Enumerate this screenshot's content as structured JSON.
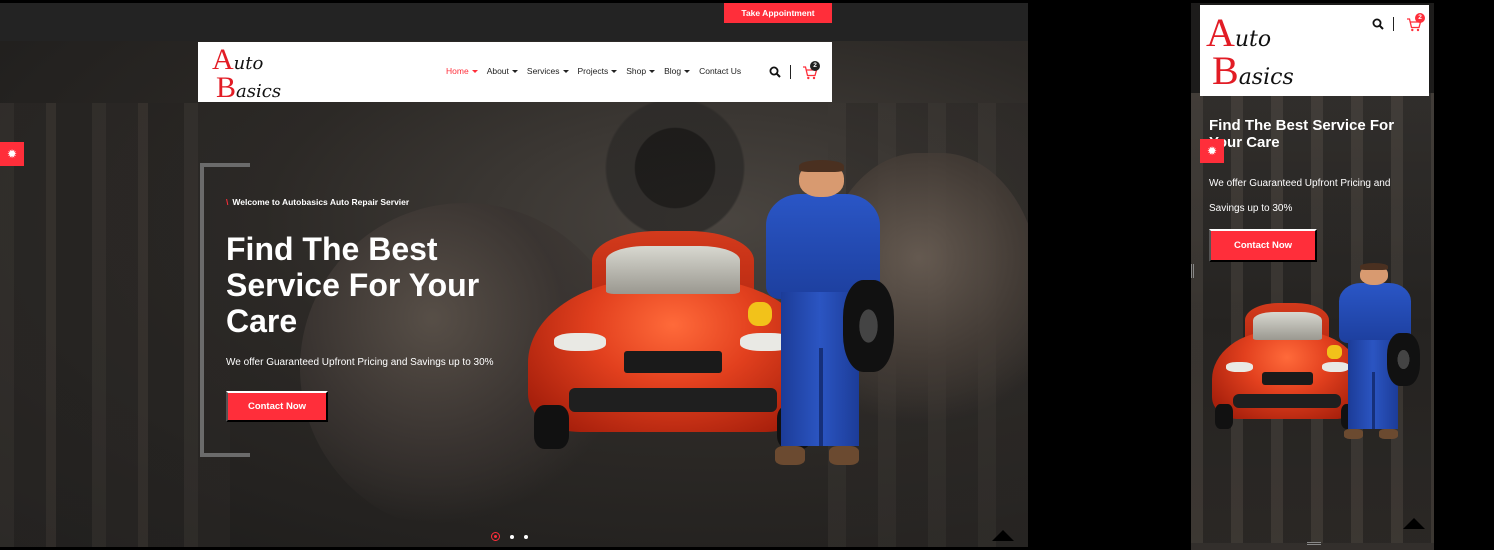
{
  "appointment": {
    "label": "Take Appointment"
  },
  "logo": {
    "line1_big": "A",
    "line1_rest": "uto",
    "line2_big": "B",
    "line2_rest": "asics"
  },
  "nav": [
    {
      "label": "Home",
      "dropdown": true,
      "active": true
    },
    {
      "label": "About",
      "dropdown": true
    },
    {
      "label": "Services",
      "dropdown": true
    },
    {
      "label": "Projects",
      "dropdown": true
    },
    {
      "label": "Shop",
      "dropdown": true
    },
    {
      "label": "Blog",
      "dropdown": true
    },
    {
      "label": "Contact Us",
      "dropdown": false
    }
  ],
  "cart": {
    "count": "2"
  },
  "hero": {
    "welcome_slash": "\\",
    "welcome": "Welcome to Autobasics Auto Repair Servier",
    "title": "Find The Best Service For Your Care",
    "subtitle": "We offer Guaranteed Upfront Pricing and Savings up to 30%",
    "cta": "Contact Now"
  },
  "mobile": {
    "title": "Find The Best Service For Your Care",
    "subtitle": "We offer Guaranteed Upfront Pricing and Savings up to 30%",
    "cta": "Contact Now",
    "cart_count": "2"
  },
  "slider": {
    "total": 3,
    "active": 1
  },
  "colors": {
    "accent": "#ff2e3a",
    "logo_red": "#e21c25",
    "logo_gear": "#2a8fd8",
    "dark": "#232323"
  },
  "icons": [
    "gear-icon",
    "search-icon",
    "cart-icon",
    "arrow-up-icon"
  ]
}
